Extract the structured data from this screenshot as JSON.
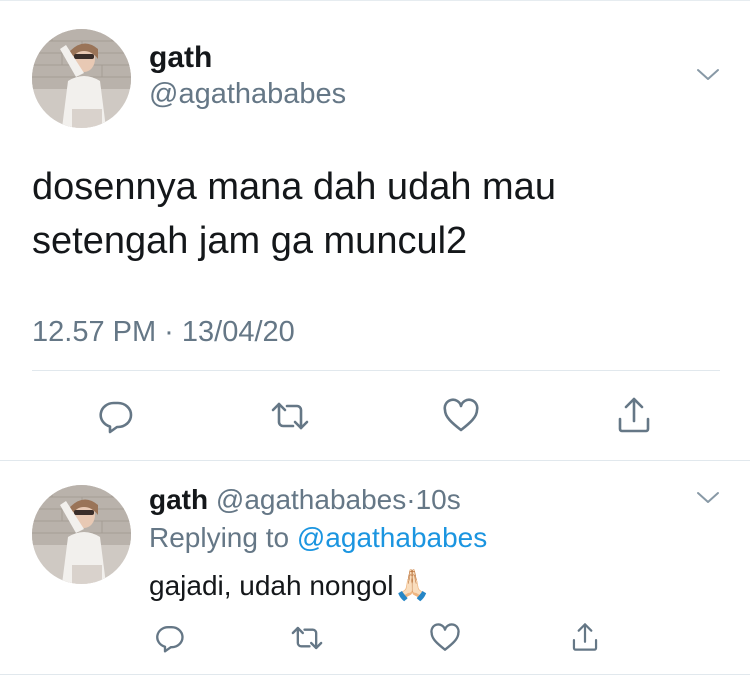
{
  "main_tweet": {
    "display_name": "gath",
    "handle": "@agathababes",
    "text_line1": "dosennya mana dah udah mau",
    "text_line2": "setengah jam ga muncul2",
    "timestamp": "12.57 PM · 13/04/20"
  },
  "reply_tweet": {
    "display_name": "gath",
    "handle": "@agathababes",
    "separator": "·",
    "age": "10s",
    "replying_prefix": "Replying to",
    "replying_to": "@agathababes",
    "text": "gajadi, udah nongol",
    "emoji": "🙏🏻"
  },
  "icons": {
    "reply": "reply-icon",
    "retweet": "retweet-icon",
    "like": "heart-icon",
    "share": "share-icon",
    "menu": "chevron-down-icon"
  },
  "colors": {
    "text": "#14171a",
    "muted": "#657786",
    "link": "#1b95e0",
    "divider": "#e1e8ed"
  }
}
